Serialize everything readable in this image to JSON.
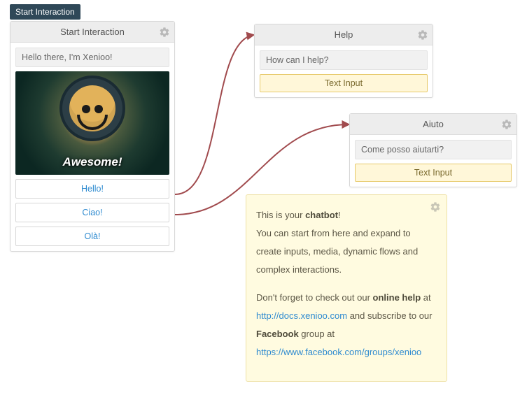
{
  "badge": {
    "label": "Start Interaction"
  },
  "start_card": {
    "title": "Start Interaction",
    "greeting": "Hello there, I'm Xenioo!",
    "media_caption": "Awesome!",
    "choices": [
      {
        "label": "Hello!"
      },
      {
        "label": "Ciao!"
      },
      {
        "label": "Olà!"
      }
    ]
  },
  "help_card": {
    "title": "Help",
    "prompt": "How can I help?",
    "input_label": "Text Input"
  },
  "aiuto_card": {
    "title": "Aiuto",
    "prompt": "Come posso aiutarti?",
    "input_label": "Text Input"
  },
  "note": {
    "l1a": "This is your ",
    "l1b": "chatbot",
    "l1c": "!",
    "l2": "You can start from here and expand to create inputs, media, dynamic flows and complex interactions.",
    "l3a": "Don't forget to check out our ",
    "l3b": "online help",
    "l3c": " at ",
    "l3_link1": "http://docs.xenioo.com",
    "l3d": " and subscribe to our ",
    "l3e": "Facebook",
    "l3f": " group at ",
    "l3_link2": "https://www.facebook.com/groups/xenioo"
  },
  "colors": {
    "connector": "#a14b4e",
    "badge_bg": "#2f4858"
  }
}
